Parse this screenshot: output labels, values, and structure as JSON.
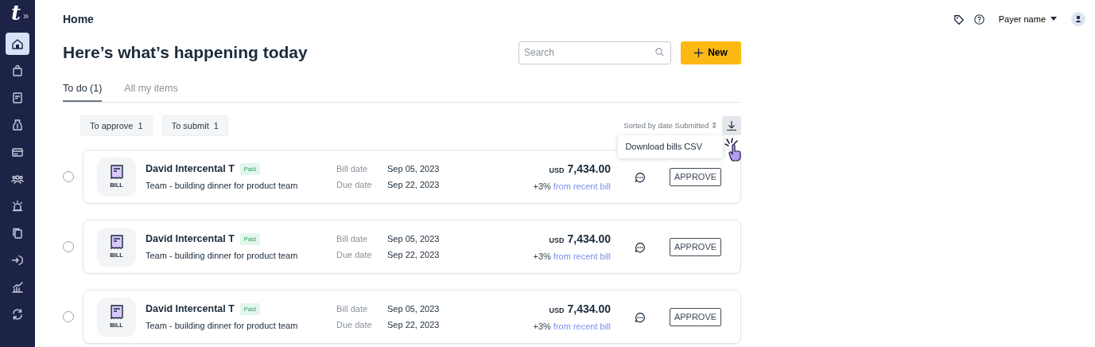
{
  "sidebar": {
    "logo": "t",
    "expand": "»",
    "items": [
      {
        "selected": true
      },
      {
        "selected": false
      },
      {
        "selected": false
      },
      {
        "selected": false
      },
      {
        "selected": false
      },
      {
        "selected": false
      },
      {
        "selected": false
      },
      {
        "selected": false
      },
      {
        "selected": false
      },
      {
        "selected": false
      },
      {
        "selected": false
      }
    ]
  },
  "header": {
    "breadcrumb": "Home",
    "user": "Payer name"
  },
  "title": "Here’s what’s happening today",
  "search": {
    "placeholder": "Search"
  },
  "new_button": "New",
  "tabs": [
    {
      "label": "To do (1)",
      "selected": true
    },
    {
      "label": "All my items",
      "selected": false
    }
  ],
  "filters": [
    {
      "label": "To approve",
      "count": "1"
    },
    {
      "label": "To submit",
      "count": "1"
    }
  ],
  "sort": {
    "label": "Sorted by date Submitted",
    "arrows": "⇕"
  },
  "menu": {
    "items": [
      "Download bills CSV"
    ]
  },
  "bills": [
    {
      "checked": false,
      "doc_label": "BILL",
      "vendor": "David Intercental T",
      "status": "Paid",
      "description": "Team - building dinner for product team",
      "bill_date_label": "Bill date",
      "bill_date": "Sep 05, 2023",
      "due_date_label": "Due date",
      "due_date": "Sep 22, 2023",
      "currency": "USD",
      "amount": "7,434.00",
      "change": "+3%",
      "change_link": "from recent bill",
      "action": "APPROVE"
    },
    {
      "checked": false,
      "doc_label": "BILL",
      "vendor": "David Intercental T",
      "status": "Paid",
      "description": "Team - building dinner for product team",
      "bill_date_label": "Bill date",
      "bill_date": "Sep 05, 2023",
      "due_date_label": "Due date",
      "due_date": "Sep 22, 2023",
      "currency": "USD",
      "amount": "7,434.00",
      "change": "+3%",
      "change_link": "from recent bill",
      "action": "APPROVE"
    },
    {
      "checked": false,
      "doc_label": "BILL",
      "vendor": "David Intercental T",
      "status": "Paid",
      "description": "Team - building dinner for product team",
      "bill_date_label": "Bill date",
      "bill_date": "Sep 05, 2023",
      "due_date_label": "Due date",
      "due_date": "Sep 22, 2023",
      "currency": "USD",
      "amount": "7,434.00",
      "change": "+3%",
      "change_link": "from recent bill",
      "action": "APPROVE"
    }
  ]
}
